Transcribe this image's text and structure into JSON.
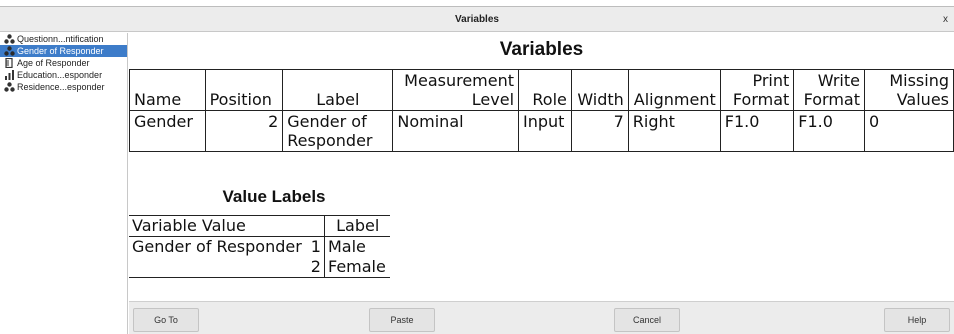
{
  "window": {
    "title": "Variables",
    "close_glyph": "x"
  },
  "sidebar": {
    "items": [
      {
        "label": "Questionn...ntification",
        "icon": "nominal-icon",
        "selected": false
      },
      {
        "label": "Gender of Responder",
        "icon": "nominal-icon",
        "selected": true
      },
      {
        "label": "Age of Responder",
        "icon": "scale-icon",
        "selected": false
      },
      {
        "label": "Education...esponder",
        "icon": "ordinal-icon",
        "selected": false
      },
      {
        "label": "Residence...esponder",
        "icon": "nominal-icon",
        "selected": false
      }
    ]
  },
  "variables": {
    "title": "Variables",
    "headers": {
      "name": "Name",
      "position": "Position",
      "label": "Label",
      "measurement_1": "Measurement",
      "measurement_2": "Level",
      "role": "Role",
      "width": "Width",
      "alignment": "Alignment",
      "print_1": "Print",
      "print_2": "Format",
      "write_1": "Write",
      "write_2": "Format",
      "missing_1": "Missing",
      "missing_2": "Values"
    },
    "row": {
      "name": "Gender",
      "position": "2",
      "label_1": "Gender of",
      "label_2": "Responder",
      "measurement": "Nominal",
      "role": "Input",
      "width": "7",
      "alignment": "Right",
      "print_format": "F1.0",
      "write_format": "F1.0",
      "missing": "0"
    }
  },
  "value_labels": {
    "title": "Value Labels",
    "header_variable_value": "Variable Value",
    "header_label": "Label",
    "variable": "Gender of Responder",
    "rows": [
      {
        "value": "1",
        "label": "Male"
      },
      {
        "value": "2",
        "label": "Female"
      }
    ]
  },
  "footer": {
    "go_to": "Go To",
    "paste": "Paste",
    "cancel": "Cancel",
    "help": "Help"
  },
  "colors": {
    "selection": "#3d7cc9",
    "chrome": "#ececec"
  }
}
